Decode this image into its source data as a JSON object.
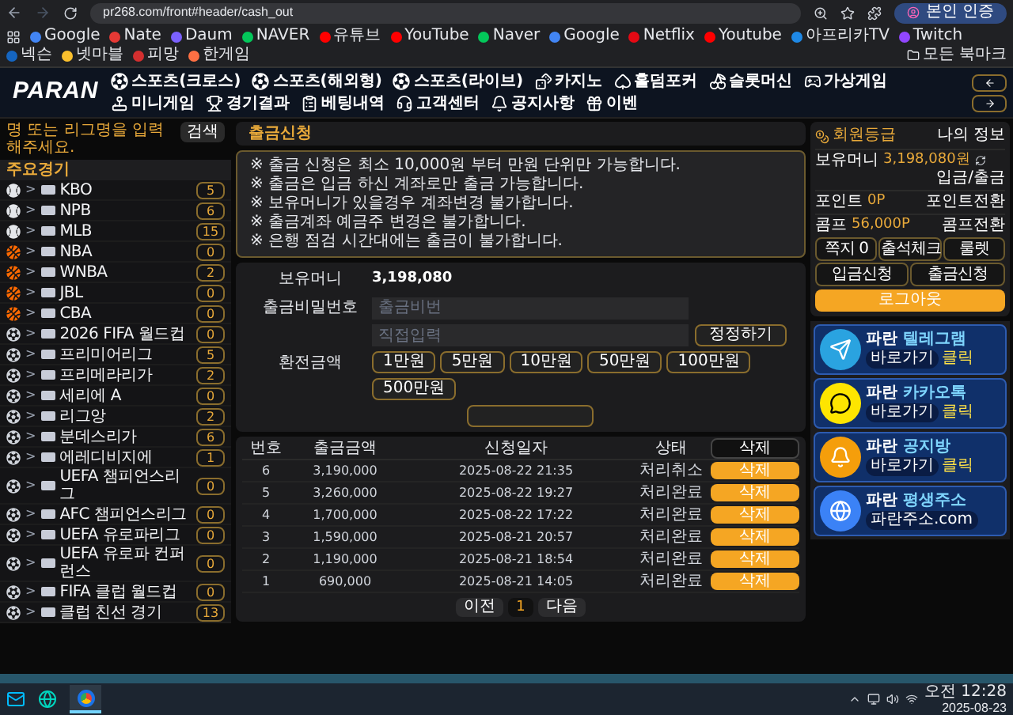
{
  "browser": {
    "url": "pr268.com/front#header/cash_out",
    "profile": "본인 인증",
    "bookmarks": [
      {
        "label": "Google",
        "color": "#4285f4"
      },
      {
        "label": "Nate",
        "color": "#e53935"
      },
      {
        "label": "Daum",
        "color": "#7b61ff"
      },
      {
        "label": "NAVER",
        "color": "#03c75a"
      },
      {
        "label": "유튜브",
        "color": "#ff0000"
      },
      {
        "label": "YouTube",
        "color": "#ff0000"
      },
      {
        "label": "Naver",
        "color": "#03c75a"
      },
      {
        "label": "Google",
        "color": "#4285f4"
      },
      {
        "label": "Netflix",
        "color": "#e50914"
      },
      {
        "label": "Youtube",
        "color": "#ff0000"
      },
      {
        "label": "아프리카TV",
        "color": "#1e88e5"
      },
      {
        "label": "Twitch",
        "color": "#9146ff"
      },
      {
        "label": "넥슨",
        "color": "#1565c0"
      },
      {
        "label": "넷마블",
        "color": "#fbc02d"
      },
      {
        "label": "피망",
        "color": "#d32f2f"
      },
      {
        "label": "한게임",
        "color": "#ff7043"
      }
    ],
    "all_bookmarks": "모든 북마크"
  },
  "header": {
    "logo": "PARAN",
    "nav": [
      {
        "label": "스포츠(크로스)",
        "kind": "sport"
      },
      {
        "label": "스포츠(해외형)",
        "kind": "sport"
      },
      {
        "label": "스포츠(라이브)",
        "kind": "sport"
      },
      {
        "label": "카지노",
        "kind": "casino"
      },
      {
        "label": "홀덤포커",
        "kind": "poker"
      },
      {
        "label": "슬롯머신",
        "kind": "slot"
      },
      {
        "label": "가상게임",
        "kind": "virtual"
      },
      {
        "label": "미니게임",
        "kind": "mini"
      },
      {
        "label": "경기결과",
        "kind": "result"
      },
      {
        "label": "베팅내역",
        "kind": "history"
      },
      {
        "label": "고객센터",
        "kind": "support"
      },
      {
        "label": "공지사항",
        "kind": "notice"
      },
      {
        "label": "이벤",
        "kind": "event"
      }
    ]
  },
  "sidebar": {
    "search_placeholder": "명 또는 리그명을 입력해주세요.",
    "search_button": "검색",
    "title": "주요경기",
    "leagues": [
      {
        "kind": "baseball",
        "arrow": ">",
        "name": "KBO",
        "count": "5"
      },
      {
        "kind": "baseball",
        "arrow": ">",
        "name": "NPB",
        "count": "6"
      },
      {
        "kind": "baseball",
        "arrow": ">",
        "name": "MLB",
        "count": "15"
      },
      {
        "kind": "basketball",
        "arrow": ">",
        "name": "NBA",
        "count": "0"
      },
      {
        "kind": "basketball",
        "arrow": ">",
        "name": "WNBA",
        "count": "2"
      },
      {
        "kind": "basketball",
        "arrow": ">",
        "name": "JBL",
        "count": "0"
      },
      {
        "kind": "basketball",
        "arrow": ">",
        "name": "CBA",
        "count": "0"
      },
      {
        "kind": "soccer",
        "arrow": ">",
        "name": "2026 FIFA 월드컵",
        "count": "0"
      },
      {
        "kind": "soccer",
        "arrow": ">",
        "name": "프리미어리그",
        "count": "5"
      },
      {
        "kind": "soccer",
        "arrow": ">",
        "name": "프리메라리가",
        "count": "2"
      },
      {
        "kind": "soccer",
        "arrow": ">",
        "name": "세리에 A",
        "count": "0"
      },
      {
        "kind": "soccer",
        "arrow": ">",
        "name": "리그앙",
        "count": "2"
      },
      {
        "kind": "soccer",
        "arrow": ">",
        "name": "분데스리가",
        "count": "6"
      },
      {
        "kind": "soccer",
        "arrow": ">",
        "name": "에레디비지에",
        "count": "1"
      },
      {
        "kind": "soccer",
        "arrow": ">",
        "name": "UEFA 챔피언스리그",
        "count": "0"
      },
      {
        "kind": "soccer",
        "arrow": ">",
        "name": "AFC 챔피언스리그",
        "count": "0"
      },
      {
        "kind": "soccer",
        "arrow": ">",
        "name": "UEFA 유로파리그",
        "count": "0"
      },
      {
        "kind": "soccer",
        "arrow": ">",
        "name": "UEFA 유로파 컨퍼런스",
        "count": "0"
      },
      {
        "kind": "soccer",
        "arrow": ">",
        "name": "FIFA 클럽 월드컵",
        "count": "0"
      },
      {
        "kind": "soccer",
        "arrow": ">",
        "name": "클럽 친선 경기",
        "count": "13"
      }
    ]
  },
  "main": {
    "title": "출금신청",
    "notices": [
      "※ 출금 신청은 최소 10,000원 부터 만원 단위만 가능합니다.",
      "※ 출금은 입금 하신 계좌로만 출금 가능합니다.",
      "※ 보유머니가 있을경우 계좌변경 불가합니다.",
      "※ 출금계좌 예금주 변경은 불가합니다.",
      "※ 은행 점검 시간대에는 출금이 불가합니다."
    ],
    "form": {
      "balance_label": "보유머니",
      "balance": "3,198,080",
      "password_label": "출금비밀번호",
      "password_placeholder": "출금비번",
      "amount_label": "환전금액",
      "amount_placeholder": "직접입력",
      "reset_button": "정정하기",
      "amounts": [
        "1만원",
        "5만원",
        "10만원",
        "50만원",
        "100만원",
        "500만원"
      ]
    },
    "table": {
      "columns": [
        "번호",
        "출금금액",
        "신청일자",
        "상태"
      ],
      "delete_all": "삭제",
      "rows": [
        {
          "no": "6",
          "amount": "3,190,000",
          "date": "2025-08-22 21:35",
          "status": "처리취소",
          "action": "삭제"
        },
        {
          "no": "5",
          "amount": "3,260,000",
          "date": "2025-08-22 19:27",
          "status": "처리완료",
          "action": "삭제"
        },
        {
          "no": "4",
          "amount": "1,700,000",
          "date": "2025-08-22 17:22",
          "status": "처리완료",
          "action": "삭제"
        },
        {
          "no": "3",
          "amount": "1,590,000",
          "date": "2025-08-21 20:57",
          "status": "처리완료",
          "action": "삭제"
        },
        {
          "no": "2",
          "amount": "1,190,000",
          "date": "2025-08-21 18:54",
          "status": "처리완료",
          "action": "삭제"
        },
        {
          "no": "1",
          "amount": "690,000",
          "date": "2025-08-21 14:05",
          "status": "처리완료",
          "action": "삭제"
        }
      ]
    },
    "pagination": {
      "prev": "이전",
      "next": "다음",
      "pages": [
        {
          "label": "1",
          "selected": true
        }
      ]
    }
  },
  "account": {
    "grade": "회원등급",
    "my_info": "나의 정보",
    "rows": [
      {
        "label": "보유머니",
        "value": "3,198,080원",
        "link": "입금/출금"
      },
      {
        "label": "포인트",
        "value": "0P",
        "link": "포인트전환"
      },
      {
        "label": "콤프",
        "value": "56,000P",
        "link": "콤프전환"
      }
    ],
    "buttons": [
      "쪽지 0",
      "출석체크",
      "룰렛",
      "입금신청",
      "출금신청"
    ],
    "logout": "로그아웃"
  },
  "banners": [
    {
      "kind": "telegram",
      "title": "파란",
      "highlight": "텔레그램",
      "sub": "바로가기",
      "cta": "클릭"
    },
    {
      "kind": "kakao",
      "title": "파란",
      "highlight": "카카오톡",
      "sub": "바로가기",
      "cta": "클릭"
    },
    {
      "kind": "notice",
      "title": "파란",
      "highlight": "공지방",
      "sub": "바로가기",
      "cta": "클릭"
    },
    {
      "kind": "address",
      "title": "파란",
      "highlight": "평생주소",
      "sub": "파란주소.com"
    }
  ],
  "taskbar": {
    "time": "오전 12:28",
    "date": "2025-08-23"
  }
}
